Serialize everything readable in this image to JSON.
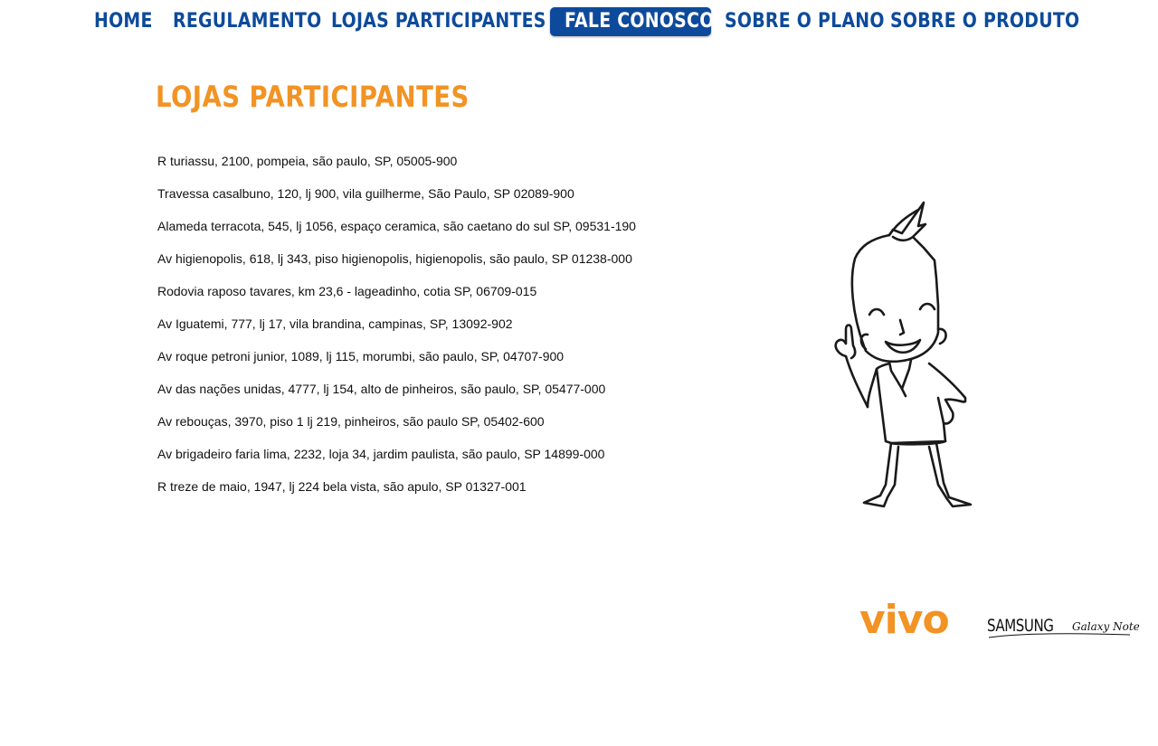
{
  "nav": {
    "items": [
      {
        "label": "HOME"
      },
      {
        "label": "REGULAMENTO"
      },
      {
        "label": "LOJAS PARTICIPANTES"
      },
      {
        "label": "FALE CONOSCO",
        "active": true
      },
      {
        "label": "SOBRE O PLANO"
      },
      {
        "label": "SOBRE O PRODUTO"
      }
    ]
  },
  "page": {
    "title": "LOJAS PARTICIPANTES"
  },
  "stores": [
    "R turiassu, 2100, pompeia, são paulo, SP, 05005-900",
    "Travessa casalbuno, 120, lj 900, vila guilherme, São Paulo, SP 02089-900",
    "Alameda terracota, 545, lj 1056, espaço ceramica, são caetano do sul SP, 09531-190",
    "Av higienopolis, 618, lj 343, piso higienopolis, higienopolis, são paulo, SP 01238-000",
    "Rodovia raposo tavares, km 23,6 - lageadinho, cotia SP, 06709-015",
    "Av Iguatemi, 777, lj 17, vila brandina, campinas, SP, 13092-902",
    "Av roque petroni junior, 1089, lj 115, morumbi, são paulo, SP, 04707-900",
    "Av das nações unidas, 4777, lj 154, alto de pinheiros, são paulo, SP, 05477-000",
    "Av rebouças, 3970, piso 1 lj 219, pinheiros, são paulo SP, 05402-600",
    "Av brigadeiro faria lima, 2232, loja 34, jardim paulista, são paulo, SP 14899-000",
    "R treze de maio, 1947, lj 224 bela vista, são apulo, SP 01327-001"
  ],
  "footer": {
    "vivo_logo_text": "vivo",
    "samsung_logo_text": "SAMSUNG",
    "samsung_product_text": "Galaxy Note"
  },
  "colors": {
    "nav_blue": "#0d4a9b",
    "accent_orange": "#f29324",
    "text": "#111111",
    "background": "#ffffff"
  },
  "icons": {
    "mascot": "mascot-illustration"
  }
}
